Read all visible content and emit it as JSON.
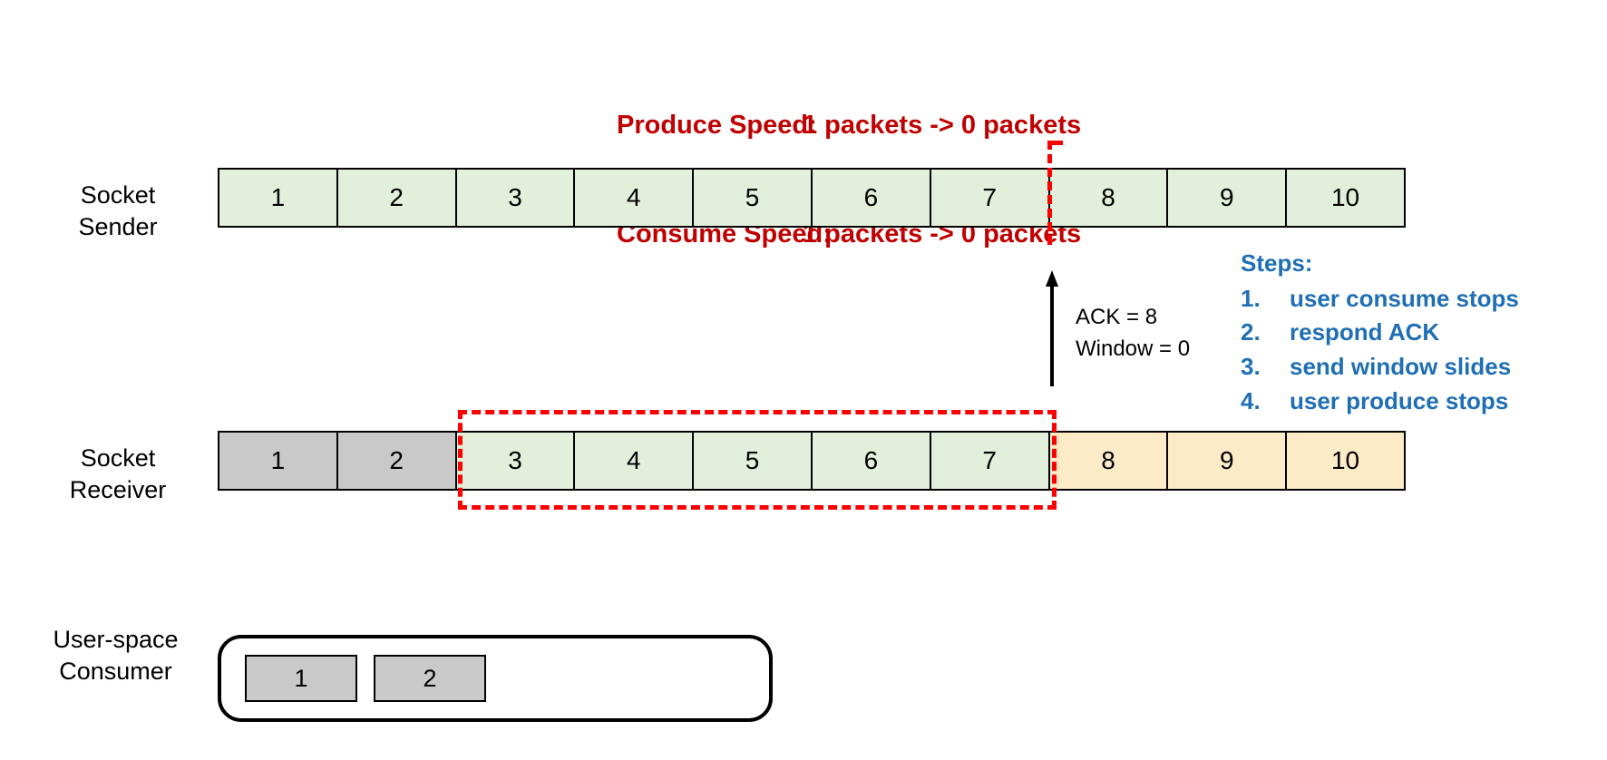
{
  "header": {
    "produce": {
      "label": "Produce Speed:",
      "value": "1 packets -> 0 packets"
    },
    "consume": {
      "label": "Consume Speed:",
      "value": "1 packets -> 0 packets"
    },
    "color": "#c00000"
  },
  "sender": {
    "label_line1": "Socket",
    "label_line2": "Sender",
    "cells": [
      {
        "text": "1",
        "state": "green"
      },
      {
        "text": "2",
        "state": "green"
      },
      {
        "text": "3",
        "state": "green"
      },
      {
        "text": "4",
        "state": "green"
      },
      {
        "text": "5",
        "state": "green"
      },
      {
        "text": "6",
        "state": "green"
      },
      {
        "text": "7",
        "state": "green"
      },
      {
        "text": "8",
        "state": "green"
      },
      {
        "text": "9",
        "state": "green"
      },
      {
        "text": "10",
        "state": "green"
      }
    ]
  },
  "receiver": {
    "label_line1": "Socket",
    "label_line2": "Receiver",
    "cells": [
      {
        "text": "1",
        "state": "grey"
      },
      {
        "text": "2",
        "state": "grey"
      },
      {
        "text": "3",
        "state": "green"
      },
      {
        "text": "4",
        "state": "green"
      },
      {
        "text": "5",
        "state": "green"
      },
      {
        "text": "6",
        "state": "green"
      },
      {
        "text": "7",
        "state": "green"
      },
      {
        "text": "8",
        "state": "orange"
      },
      {
        "text": "9",
        "state": "orange"
      },
      {
        "text": "10",
        "state": "orange"
      }
    ]
  },
  "ack": {
    "line1": "ACK = 8",
    "line2": "Window = 0"
  },
  "steps": {
    "title": "Steps:",
    "items": [
      {
        "num": "1.",
        "text": "user consume stops"
      },
      {
        "num": "2.",
        "text": "respond ACK"
      },
      {
        "num": "3.",
        "text": "send window slides"
      },
      {
        "num": "4.",
        "text": "user produce stops"
      }
    ],
    "color": "#1f6fb5"
  },
  "consumer": {
    "label_line1": "User-space",
    "label_line2": "Consumer",
    "items": [
      {
        "text": "1"
      },
      {
        "text": "2"
      }
    ]
  },
  "colors": {
    "green": "#e2efda",
    "grey": "#c9c9c9",
    "orange": "#fdebc8",
    "marker_red": "#ff0000",
    "text_black": "#000000"
  }
}
